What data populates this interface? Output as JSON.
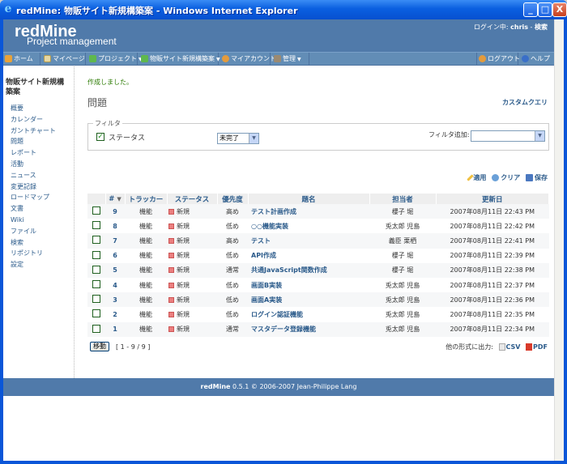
{
  "window": {
    "title": "redMine: 物販サイト新規構築案 - Windows Internet Explorer",
    "min_label": "_",
    "max_label": "□",
    "close_label": "X"
  },
  "header": {
    "logo": "redMine",
    "subtitle": "Project management",
    "login_prefix": "ログイン中:",
    "user": "chris",
    "search_sep": " - ",
    "search": "検索"
  },
  "menu": {
    "home": "ホーム",
    "mypage": "マイページ",
    "projects": "プロジェクト",
    "current_project": "物販サイト新規構築案",
    "account": "マイアカウント",
    "admin": "管理",
    "logout": "ログアウト",
    "help": "ヘルプ",
    "dropdown_glyph": "▼"
  },
  "sidebar": {
    "project_name": "物販サイト新規構築案",
    "items": [
      "概要",
      "カレンダー",
      "ガントチャート",
      "問題",
      "レポート",
      "活動",
      "ニュース",
      "変更記録",
      "ロードマップ",
      "文書",
      "Wiki",
      "ファイル",
      "検索",
      "リポジトリ",
      "設定"
    ]
  },
  "content": {
    "flash": "作成しました。",
    "heading": "問題",
    "custom_query": "カスタムクエリ",
    "filter_legend": "フィルタ",
    "filter_status_label": "ステータス",
    "filter_status_value": "未完了",
    "filter_add_label": "フィルタ追加:",
    "filter_add_value": "",
    "apply": "適用",
    "clear": "クリア",
    "save": "保存",
    "move": "移動",
    "pager": "[ 1 - 9 / 9 ]",
    "export_label": "他の形式に出力:",
    "csv": "CSV",
    "pdf": "PDF"
  },
  "table": {
    "headers": {
      "id": "#",
      "tracker": "トラッカー",
      "status": "ステータス",
      "priority": "優先度",
      "subject": "題名",
      "assignee": "担当者",
      "updated": "更新日"
    },
    "rows": [
      {
        "id": "9",
        "tracker": "機能",
        "status": "新規",
        "priority": "高め",
        "subject": "テスト計画作成",
        "assignee": "櫻子 堀",
        "updated": "2007年08月11日 22:43 PM"
      },
      {
        "id": "8",
        "tracker": "機能",
        "status": "新規",
        "priority": "低め",
        "subject": "○○機能実装",
        "assignee": "兎太郎 児島",
        "updated": "2007年08月11日 22:42 PM"
      },
      {
        "id": "7",
        "tracker": "機能",
        "status": "新規",
        "priority": "高め",
        "subject": "テスト",
        "assignee": "義臣 栗栖",
        "updated": "2007年08月11日 22:41 PM"
      },
      {
        "id": "6",
        "tracker": "機能",
        "status": "新規",
        "priority": "低め",
        "subject": "API作成",
        "assignee": "櫻子 堀",
        "updated": "2007年08月11日 22:39 PM"
      },
      {
        "id": "5",
        "tracker": "機能",
        "status": "新規",
        "priority": "通常",
        "subject": "共通JavaScript関数作成",
        "assignee": "櫻子 堀",
        "updated": "2007年08月11日 22:38 PM"
      },
      {
        "id": "4",
        "tracker": "機能",
        "status": "新規",
        "priority": "低め",
        "subject": "画面B実装",
        "assignee": "兎太郎 児島",
        "updated": "2007年08月11日 22:37 PM"
      },
      {
        "id": "3",
        "tracker": "機能",
        "status": "新規",
        "priority": "低め",
        "subject": "画面A実装",
        "assignee": "兎太郎 児島",
        "updated": "2007年08月11日 22:36 PM"
      },
      {
        "id": "2",
        "tracker": "機能",
        "status": "新規",
        "priority": "低め",
        "subject": "ログイン認証機能",
        "assignee": "兎太郎 児島",
        "updated": "2007年08月11日 22:35 PM"
      },
      {
        "id": "1",
        "tracker": "機能",
        "status": "新規",
        "priority": "通常",
        "subject": "マスタデータ登録機能",
        "assignee": "兎太郎 児島",
        "updated": "2007年08月11日 22:34 PM"
      }
    ]
  },
  "footer": {
    "brand": "redMine",
    "version": "0.5.1 © 2006-2007 Jean-Philippe Lang"
  },
  "colors": {
    "header_bg": "#507aaa",
    "menu_bg": "#628db6",
    "link": "#2a5a8a",
    "flash": "#2a7a00",
    "status_new": "#eb7f7f"
  }
}
